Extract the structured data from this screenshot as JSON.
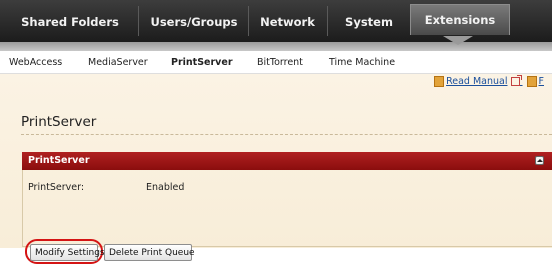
{
  "topnav": {
    "tabs": [
      {
        "label": "Shared Folders"
      },
      {
        "label": "Users/Groups"
      },
      {
        "label": "Network"
      },
      {
        "label": "System"
      },
      {
        "label": "Extensions",
        "active": true
      }
    ]
  },
  "subnav": {
    "items": [
      {
        "label": "WebAccess"
      },
      {
        "label": "MediaServer"
      },
      {
        "label": "PrintServer",
        "active": true
      },
      {
        "label": "BitTorrent"
      },
      {
        "label": "Time Machine"
      }
    ]
  },
  "manual": {
    "label": "Read Manual",
    "extra": "F"
  },
  "page": {
    "title": "PrintServer"
  },
  "panel": {
    "title": "PrintServer",
    "fields": [
      {
        "label": "PrintServer:",
        "value": "Enabled"
      }
    ],
    "buttons": {
      "modify": "Modify Settings",
      "delete": "Delete Print Queue"
    }
  },
  "colors": {
    "panel_header": "#9a1414",
    "highlight": "#d41414",
    "link": "#1b4f9c"
  }
}
